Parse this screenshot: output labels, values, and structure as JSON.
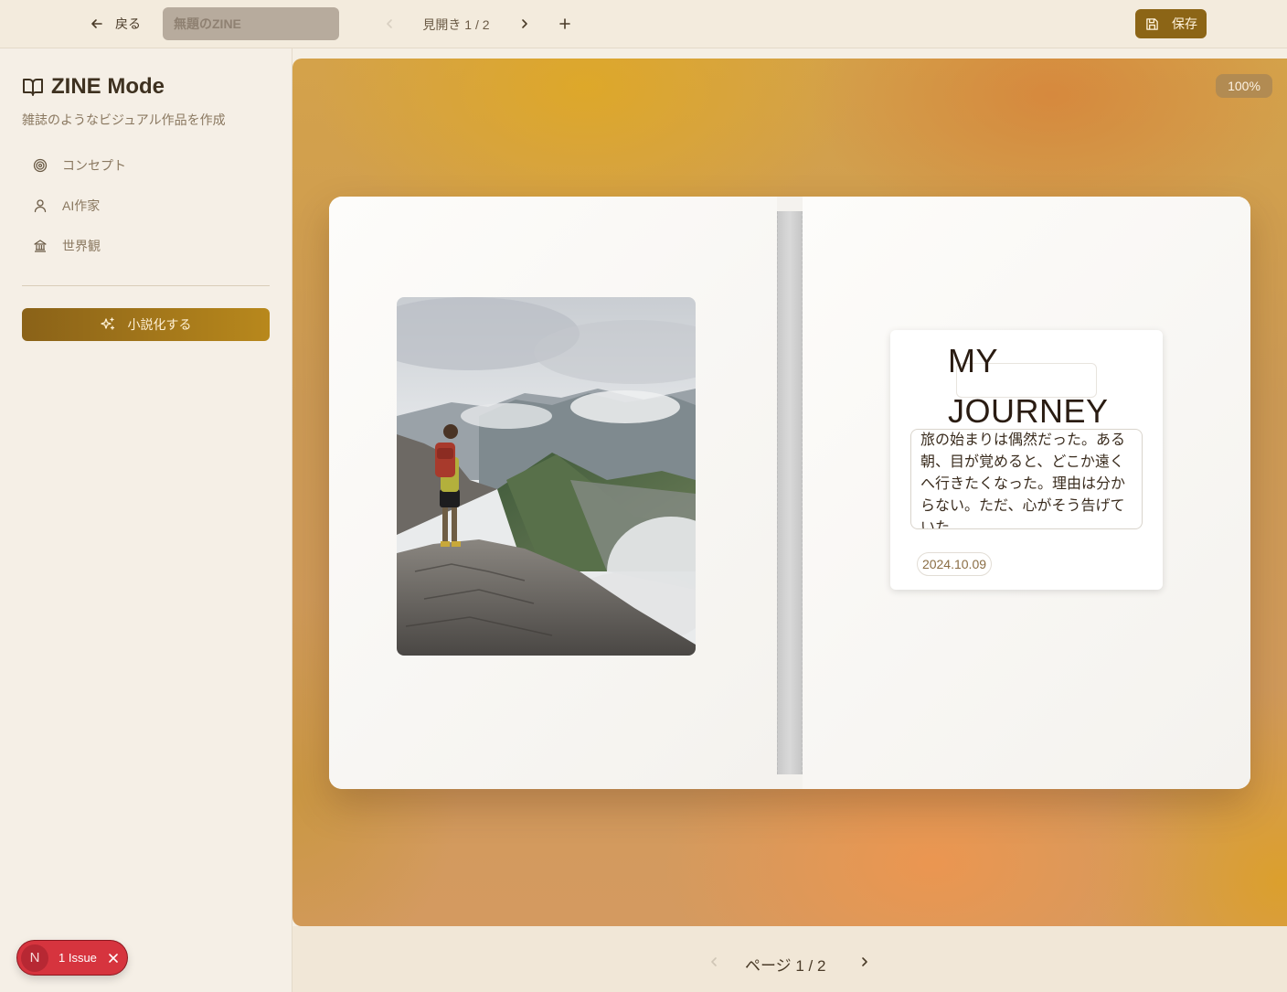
{
  "topbar": {
    "back_label": "戻る",
    "title_placeholder": "無題のZINE",
    "title_value": "",
    "spread_indicator": "見開き 1 / 2",
    "save_label": "保存"
  },
  "sidebar": {
    "brand_title": "ZINE Mode",
    "brand_subtitle": "雑誌のようなビジュアル作品を作成",
    "items": [
      {
        "label": "コンセプト",
        "icon": "target-icon"
      },
      {
        "label": "AI作家",
        "icon": "user-icon"
      },
      {
        "label": "世界観",
        "icon": "landmark-icon"
      }
    ],
    "novel_button_label": "小説化する"
  },
  "canvas": {
    "zoom": "100%",
    "right_page": {
      "title": "MY JOURNEY",
      "body": "旅の始まりは偶然だった。ある朝、目が覚めると、どこか遠くへ行きたくなった。理由は分からない。ただ、心がそう告げていた。",
      "date": "2024.10.09"
    }
  },
  "pager": {
    "page_indicator": "ページ 1 / 2"
  },
  "issues": {
    "badge_letter": "N",
    "label": "1 Issue"
  },
  "colors": {
    "accent": "#8c6516",
    "background": "#f5efe4",
    "issue_red": "#d6343e"
  }
}
